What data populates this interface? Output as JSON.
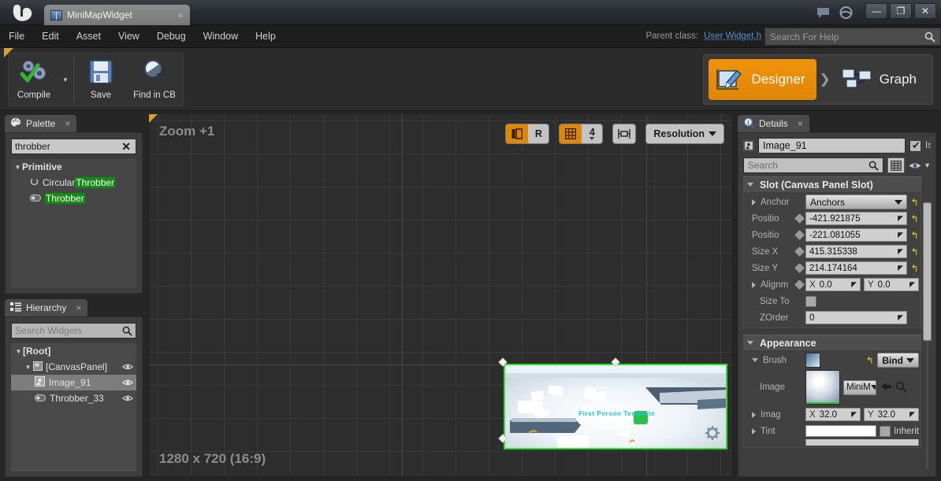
{
  "window": {
    "tab_title": "MiniMapWidget",
    "tab_close": "×",
    "minimize": "—",
    "maximize": "❐",
    "close": "✕",
    "logo": "𝔲"
  },
  "menubar": {
    "items": [
      "File",
      "Edit",
      "Asset",
      "View",
      "Debug",
      "Window",
      "Help"
    ],
    "parent_class_label": "Parent class:",
    "parent_class_value": "User Widget.h",
    "help_placeholder": "Search For Help"
  },
  "toolbar": {
    "compile_label": "Compile",
    "compile_dropdown": "▼",
    "save_label": "Save",
    "find_label": "Find in CB"
  },
  "modes": {
    "designer_label": "Designer",
    "separator": "❯",
    "graph_label": "Graph",
    "active": "Designer"
  },
  "palette": {
    "tab_title": "Palette",
    "tab_close": "×",
    "search_value": "throbber",
    "clear_label": "✕",
    "category": "Primitive",
    "items": [
      {
        "prefix": "Circular ",
        "match": "Throbber",
        "suffix": ""
      },
      {
        "prefix": "",
        "match": "Throbber",
        "suffix": ""
      }
    ]
  },
  "hierarchy": {
    "tab_title": "Hierarchy",
    "tab_close": "×",
    "search_placeholder": "Search Widgets",
    "rows": [
      {
        "label": "[Root]",
        "depth": 0,
        "expander": "▼",
        "selected": false,
        "eye": false
      },
      {
        "label": "[CanvasPanel]",
        "depth": 1,
        "expander": "▼",
        "selected": false,
        "eye": true
      },
      {
        "label": "Image_91",
        "depth": 2,
        "expander": "",
        "selected": true,
        "eye": true
      },
      {
        "label": "Throbber_33",
        "depth": 2,
        "expander": "",
        "selected": false,
        "eye": true
      }
    ]
  },
  "viewport": {
    "zoom_label": "Zoom +1",
    "resolution_label": "1280 x 720 (16:9)",
    "toolbar": {
      "fill_screen_icon": "fill-screen-icon",
      "r_label": "R",
      "grid_icon": "grid-icon",
      "grid_snap_value": "4",
      "grid_snap_caret": "▾",
      "outline_icon": "widget-outline-icon",
      "resolution_button": "Resolution",
      "resolution_caret": "▼"
    },
    "selected_widget": {
      "name": "Image_91",
      "outline_color": "#2fe22f",
      "scene_text": "First Person Template"
    }
  },
  "details": {
    "tab_title": "Details",
    "tab_close": "×",
    "widget_name": "Image_91",
    "is_variable_label": "Is",
    "search_placeholder": "Search",
    "categories": [
      {
        "title": "Slot (Canvas Panel Slot)",
        "rows": [
          {
            "label": "Anchor",
            "type": "combo",
            "value": "Anchors",
            "revert": true,
            "tri": "closed"
          },
          {
            "label": "Positio",
            "type": "number",
            "value": "-421.921875",
            "revert": true,
            "bindpin": true
          },
          {
            "label": "Positio",
            "type": "number",
            "value": "-221.081055",
            "revert": true,
            "bindpin": true
          },
          {
            "label": "Size X",
            "type": "number",
            "value": "415.315338",
            "revert": true,
            "bindpin": true
          },
          {
            "label": "Size Y",
            "type": "number",
            "value": "214.174164",
            "revert": true,
            "bindpin": true
          },
          {
            "label": "Alignm",
            "type": "vec2",
            "x_axis": "X",
            "x_value": "0.0",
            "y_axis": "Y",
            "y_value": "0.0",
            "tri": "closed",
            "bindpin": true
          },
          {
            "label": "Size To",
            "type": "checkbox",
            "value": ""
          },
          {
            "label": "ZOrder",
            "type": "number",
            "value": "0"
          }
        ]
      },
      {
        "title": "Appearance",
        "rows": [
          {
            "label": "Brush",
            "type": "brush",
            "bind_label": "Bind",
            "bind_caret": "▼",
            "revert": true,
            "tri": "open"
          },
          {
            "label": "Image",
            "type": "asset",
            "asset_value": "MiniM",
            "asset_caret": "▼",
            "browse_icon": "browse-icon",
            "find_icon": "find-icon"
          },
          {
            "label": "Imag",
            "type": "vec2",
            "x_axis": "X",
            "x_value": "32.0",
            "y_axis": "Y",
            "y_value": "32.0",
            "tri": "closed"
          },
          {
            "label": "Tint",
            "type": "color",
            "value": "#ffffff",
            "inherit_label": "Inherit",
            "tri": "closed"
          }
        ]
      }
    ]
  }
}
